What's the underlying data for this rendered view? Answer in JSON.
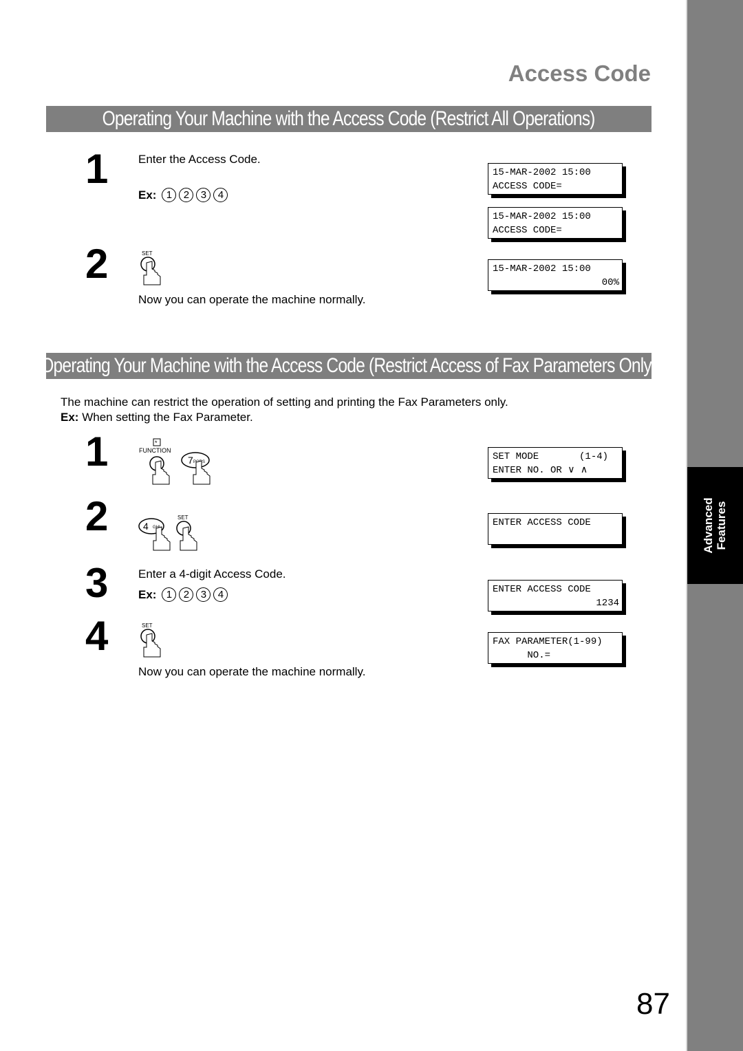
{
  "section_heading": "Access Code",
  "sidebar_tab": {
    "line1": "Advanced",
    "line2": "Features"
  },
  "page_number": "87",
  "section1": {
    "title": "Operating Your Machine with the Access Code (Restrict All Operations)",
    "steps": [
      {
        "num": "1",
        "text": "Enter the Access Code.",
        "ex_label": "Ex:",
        "ex_keys": [
          "1",
          "2",
          "3",
          "4"
        ]
      },
      {
        "num": "2",
        "key": "SET",
        "text": "Now you can operate the machine normally."
      }
    ],
    "displays": [
      {
        "line1": "15-MAR-2002 15:00",
        "line2": "ACCESS CODE="
      },
      {
        "line1": "15-MAR-2002 15:00",
        "line2": "ACCESS CODE="
      },
      {
        "line1": "15-MAR-2002 15:00",
        "line2": "00%"
      }
    ]
  },
  "section2": {
    "title": "Operating Your Machine with the Access Code (Restrict Access of Fax Parameters Only)",
    "intro": "The machine can restrict the operation of setting and printing the Fax Parameters only.",
    "ex_label": "Ex:",
    "ex_text": "When setting the Fax Parameter.",
    "steps": [
      {
        "num": "1",
        "keys": [
          "FUNCTION",
          "7PQRS"
        ]
      },
      {
        "num": "2",
        "keys": [
          "4GHI",
          "SET"
        ]
      },
      {
        "num": "3",
        "text": "Enter a 4-digit Access Code.",
        "ex_label": "Ex:",
        "ex_keys": [
          "1",
          "2",
          "3",
          "4"
        ]
      },
      {
        "num": "4",
        "key": "SET",
        "text": "Now you can operate the machine normally."
      }
    ],
    "displays": [
      {
        "line1": "SET MODE       (1-4)",
        "line2": "ENTER NO. OR ∨ ∧"
      },
      {
        "line1": "ENTER ACCESS CODE",
        "line2": ""
      },
      {
        "line1": "ENTER ACCESS CODE",
        "line2": "1234"
      },
      {
        "line1": "FAX PARAMETER(1-99)",
        "line2": "      NO.="
      }
    ]
  }
}
